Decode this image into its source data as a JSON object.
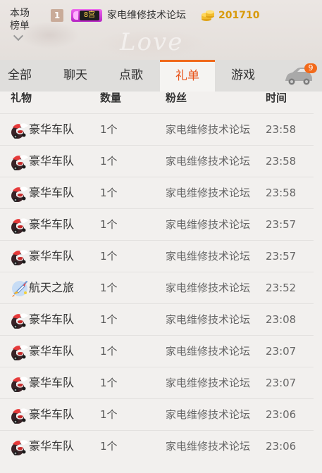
{
  "ranking": {
    "title": "本场榜单",
    "rank": "1",
    "vip_label": "8宫",
    "user_name": "家电维修技术论坛",
    "coins": "201710"
  },
  "tabs": [
    {
      "label": "全部",
      "active": false
    },
    {
      "label": "聊天",
      "active": false
    },
    {
      "label": "点歌",
      "active": false
    },
    {
      "label": "礼单",
      "active": true
    },
    {
      "label": "游戏",
      "active": false
    }
  ],
  "car": {
    "icon": "car-icon",
    "badge": "9"
  },
  "table": {
    "headers": {
      "gift": "礼物",
      "qty": "数量",
      "fan": "粉丝",
      "time": "时间"
    },
    "rows": [
      {
        "icon": "luxury-fleet-icon",
        "gift": "豪华车队",
        "qty": "1个",
        "fan": "家电维修技术论坛",
        "time": "23:58"
      },
      {
        "icon": "luxury-fleet-icon",
        "gift": "豪华车队",
        "qty": "1个",
        "fan": "家电维修技术论坛",
        "time": "23:58"
      },
      {
        "icon": "luxury-fleet-icon",
        "gift": "豪华车队",
        "qty": "1个",
        "fan": "家电维修技术论坛",
        "time": "23:58"
      },
      {
        "icon": "luxury-fleet-icon",
        "gift": "豪华车队",
        "qty": "1个",
        "fan": "家电维修技术论坛",
        "time": "23:57"
      },
      {
        "icon": "luxury-fleet-icon",
        "gift": "豪华车队",
        "qty": "1个",
        "fan": "家电维修技术论坛",
        "time": "23:57"
      },
      {
        "icon": "space-trip-icon",
        "gift": "航天之旅",
        "qty": "1个",
        "fan": "家电维修技术论坛",
        "time": "23:52"
      },
      {
        "icon": "luxury-fleet-icon",
        "gift": "豪华车队",
        "qty": "1个",
        "fan": "家电维修技术论坛",
        "time": "23:08"
      },
      {
        "icon": "luxury-fleet-icon",
        "gift": "豪华车队",
        "qty": "1个",
        "fan": "家电维修技术论坛",
        "time": "23:07"
      },
      {
        "icon": "luxury-fleet-icon",
        "gift": "豪华车队",
        "qty": "1个",
        "fan": "家电维修技术论坛",
        "time": "23:07"
      },
      {
        "icon": "luxury-fleet-icon",
        "gift": "豪华车队",
        "qty": "1个",
        "fan": "家电维修技术论坛",
        "time": "23:06"
      },
      {
        "icon": "luxury-fleet-icon",
        "gift": "豪华车队",
        "qty": "1个",
        "fan": "家电维修技术论坛",
        "time": "23:06"
      }
    ]
  },
  "colors": {
    "accent": "#f06a1c",
    "coin": "#d89a0a",
    "vip": "#c42fd0"
  }
}
